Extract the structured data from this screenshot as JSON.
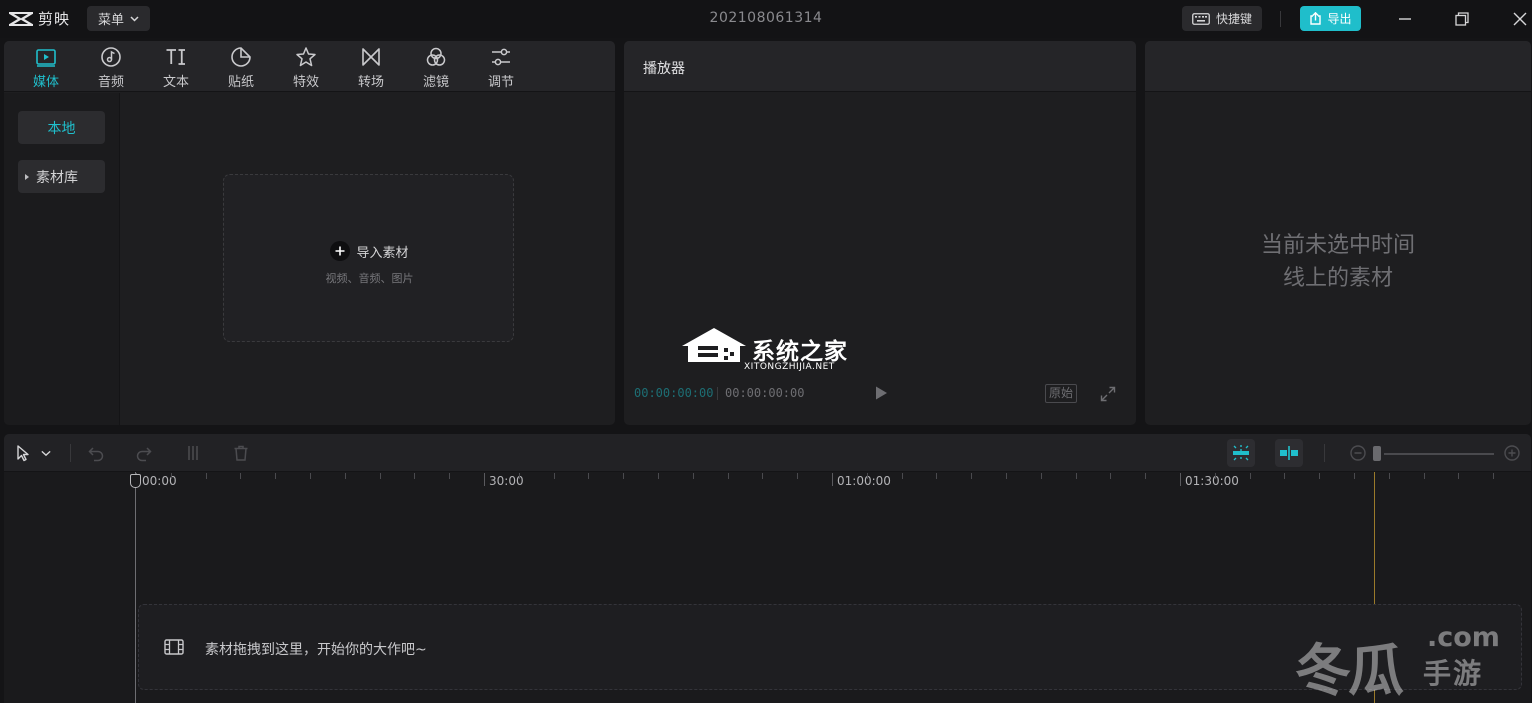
{
  "app": {
    "name": "剪映",
    "menu_label": "菜单",
    "document_title": "202108061314",
    "shortcut_label": "快捷键",
    "export_label": "导出",
    "accent_color": "#20bfcc"
  },
  "media_panel": {
    "tabs": [
      {
        "label": "媒体",
        "icon": "media-play-icon",
        "active": true
      },
      {
        "label": "音频",
        "icon": "music-note-icon",
        "active": false
      },
      {
        "label": "文本",
        "icon": "text-ti-icon",
        "active": false
      },
      {
        "label": "贴纸",
        "icon": "sticker-icon",
        "active": false
      },
      {
        "label": "特效",
        "icon": "star-effect-icon",
        "active": false
      },
      {
        "label": "转场",
        "icon": "bowtie-transition-icon",
        "active": false
      },
      {
        "label": "滤镜",
        "icon": "circles-filter-icon",
        "active": false
      },
      {
        "label": "调节",
        "icon": "sliders-adjust-icon",
        "active": false
      }
    ],
    "sidebar": [
      {
        "label": "本地",
        "active": true
      },
      {
        "label": "素材库",
        "active": false
      }
    ],
    "import": {
      "label": "导入素材",
      "sub": "视频、音频、图片"
    }
  },
  "player": {
    "title": "播放器",
    "current_time": "00:00:00:00",
    "total_time": "00:00:00:00",
    "ratio_label": "原始"
  },
  "properties": {
    "empty_line1": "当前未选中时间",
    "empty_line2": "线上的素材"
  },
  "watermark_center": {
    "main": "系统之家",
    "sub": "XITONGZHIJIA.NET"
  },
  "timeline": {
    "ruler_labels": [
      "00:00",
      "30:00",
      "01:00:00",
      "01:30:00"
    ],
    "drop_hint": "素材拖拽到这里，开始你的大作吧~"
  },
  "watermark_corner": {
    "big": "冬瓜",
    "com": ".com",
    "game": "手游"
  }
}
